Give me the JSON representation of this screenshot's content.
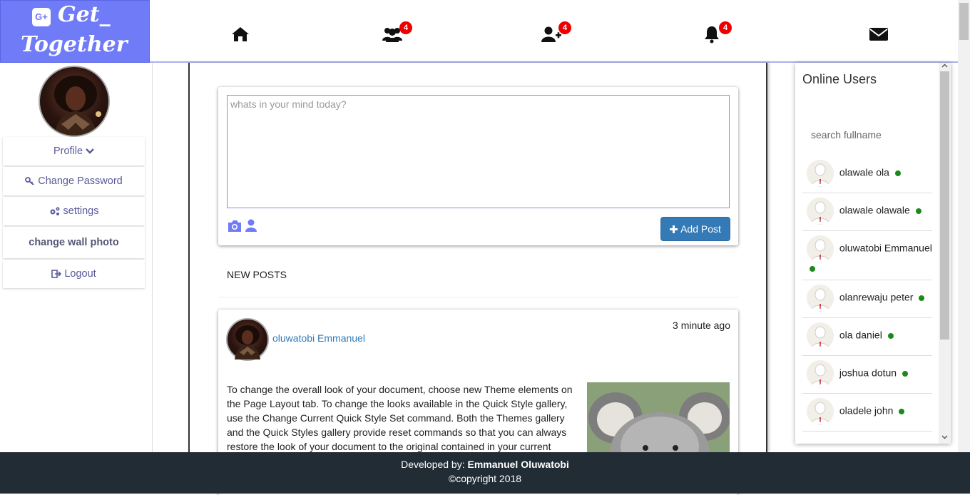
{
  "brand": {
    "line1": "Get_",
    "line2": "Together",
    "logo_letters": "G+"
  },
  "nav": {
    "home": {
      "icon": "home-icon"
    },
    "friends": {
      "icon": "users-icon",
      "badge": "4"
    },
    "friend_requests": {
      "icon": "user-plus-icon",
      "badge": "4"
    },
    "notifications": {
      "icon": "bell-icon",
      "badge": "4"
    },
    "messages": {
      "icon": "envelope-icon"
    }
  },
  "sidebar": {
    "profile": "Profile",
    "change_password": "Change Password",
    "settings": "settings",
    "change_wall_photo": "change wall photo",
    "logout": "Logout"
  },
  "composer": {
    "placeholder": "whats in your mind today?",
    "add_post_label": "Add Post"
  },
  "feed": {
    "section_title": "NEW POSTS",
    "posts": [
      {
        "author": "oluwatobi Emmanuel",
        "time": "3 minute ago",
        "text": "To change the overall look of your document, choose new Theme elements on the Page Layout tab. To change the looks available in the Quick Style gallery, use the Change Current Quick Style Set command. Both the Themes gallery and the Quick Styles gallery provide reset commands so that you can always restore the look of your document to the original contained in your current"
      }
    ]
  },
  "online_users": {
    "title": "Online Users",
    "search_placeholder": "search fullname",
    "users": [
      {
        "name": "olawale ola"
      },
      {
        "name": "olawale olawale"
      },
      {
        "name": "oluwatobi Emmanuel"
      },
      {
        "name": "olanrewaju peter"
      },
      {
        "name": "ola daniel"
      },
      {
        "name": "joshua dotun"
      },
      {
        "name": "oladele john"
      }
    ],
    "status_color": "#1a8a1a"
  },
  "footer": {
    "developed_by_label": "Developed by:",
    "developer": "Emmanuel Oluwatobi",
    "copyright": "©copyright 2018"
  },
  "colors": {
    "brand": "#6f7bf7",
    "primary_button": "#337ab7",
    "badge": "#ee0000",
    "footer": "#222c35"
  }
}
